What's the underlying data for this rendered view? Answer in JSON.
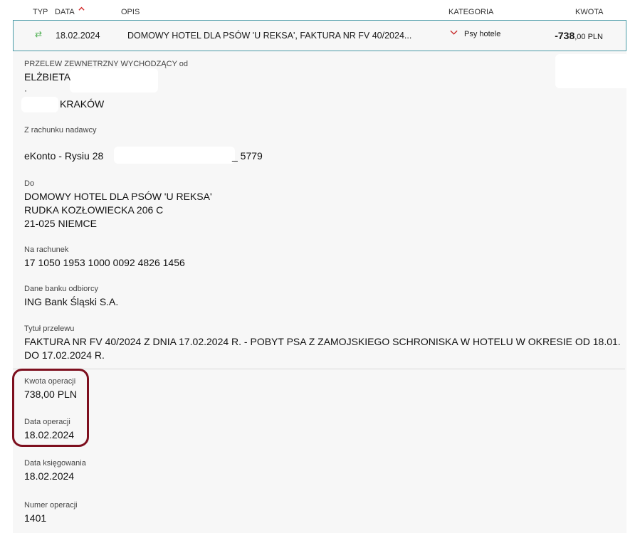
{
  "columns": {
    "typ": "TYP",
    "data": "DATA",
    "opis": "OPIS",
    "kategoria": "KATEGORIA",
    "kwota": "KWOTA"
  },
  "transaction": {
    "date": "18.02.2024",
    "description": "DOMOWY HOTEL DLA PSÓW 'U REKSA', FAKTURA NR FV 40/2024...",
    "category": "Psy hotele",
    "amount_main": "-738",
    "amount_rest": ",00 PLN"
  },
  "details": {
    "transfer_type": "PRZELEW ZEWNETRZNY WYCHODZĄCY od",
    "sender_name": "ELŻBIETA",
    "sender_dot": "·",
    "sender_city": "KRAKÓW",
    "from_account_label": "Z rachunku nadawcy",
    "from_account_name": "eKonto - Rysiu 28",
    "from_account_suffix": "_ 5779",
    "to_label": "Do",
    "to_line1": "DOMOWY HOTEL DLA PSÓW 'U REKSA'",
    "to_line2": "RUDKA KOZŁOWIECKA 206 C",
    "to_line3": "21-025 NIEMCE",
    "account_label": "Na rachunek",
    "account_number": "17 1050 1953 1000 0092 4826 1456",
    "bank_label": "Dane banku odbiorcy",
    "bank_name": "ING Bank Śląski S.A.",
    "title_label": "Tytuł przelewu",
    "title_line1": "FAKTURA NR FV 40/2024 Z DNIA 17.02.2024 R. - POBYT PSA Z ZAMOJSKIEGO SCHRONISKA W HOTELU W OKRESIE OD 18.01.",
    "title_line2": "DO 17.02.2024 R.",
    "amount_label": "Kwota operacji",
    "amount_value": "738,00 PLN",
    "op_date_label": "Data operacji",
    "op_date_value": "18.02.2024",
    "booking_date_label": "Data księgowania",
    "booking_date_value": "18.02.2024",
    "op_number_label": "Numer operacji",
    "op_number_value": "1401"
  },
  "colors": {
    "row_border": "#4a9ba7",
    "highlight": "#7d0f1e",
    "transfer_icon": "#4caf50",
    "sort_arrow": "#d32f2f"
  }
}
